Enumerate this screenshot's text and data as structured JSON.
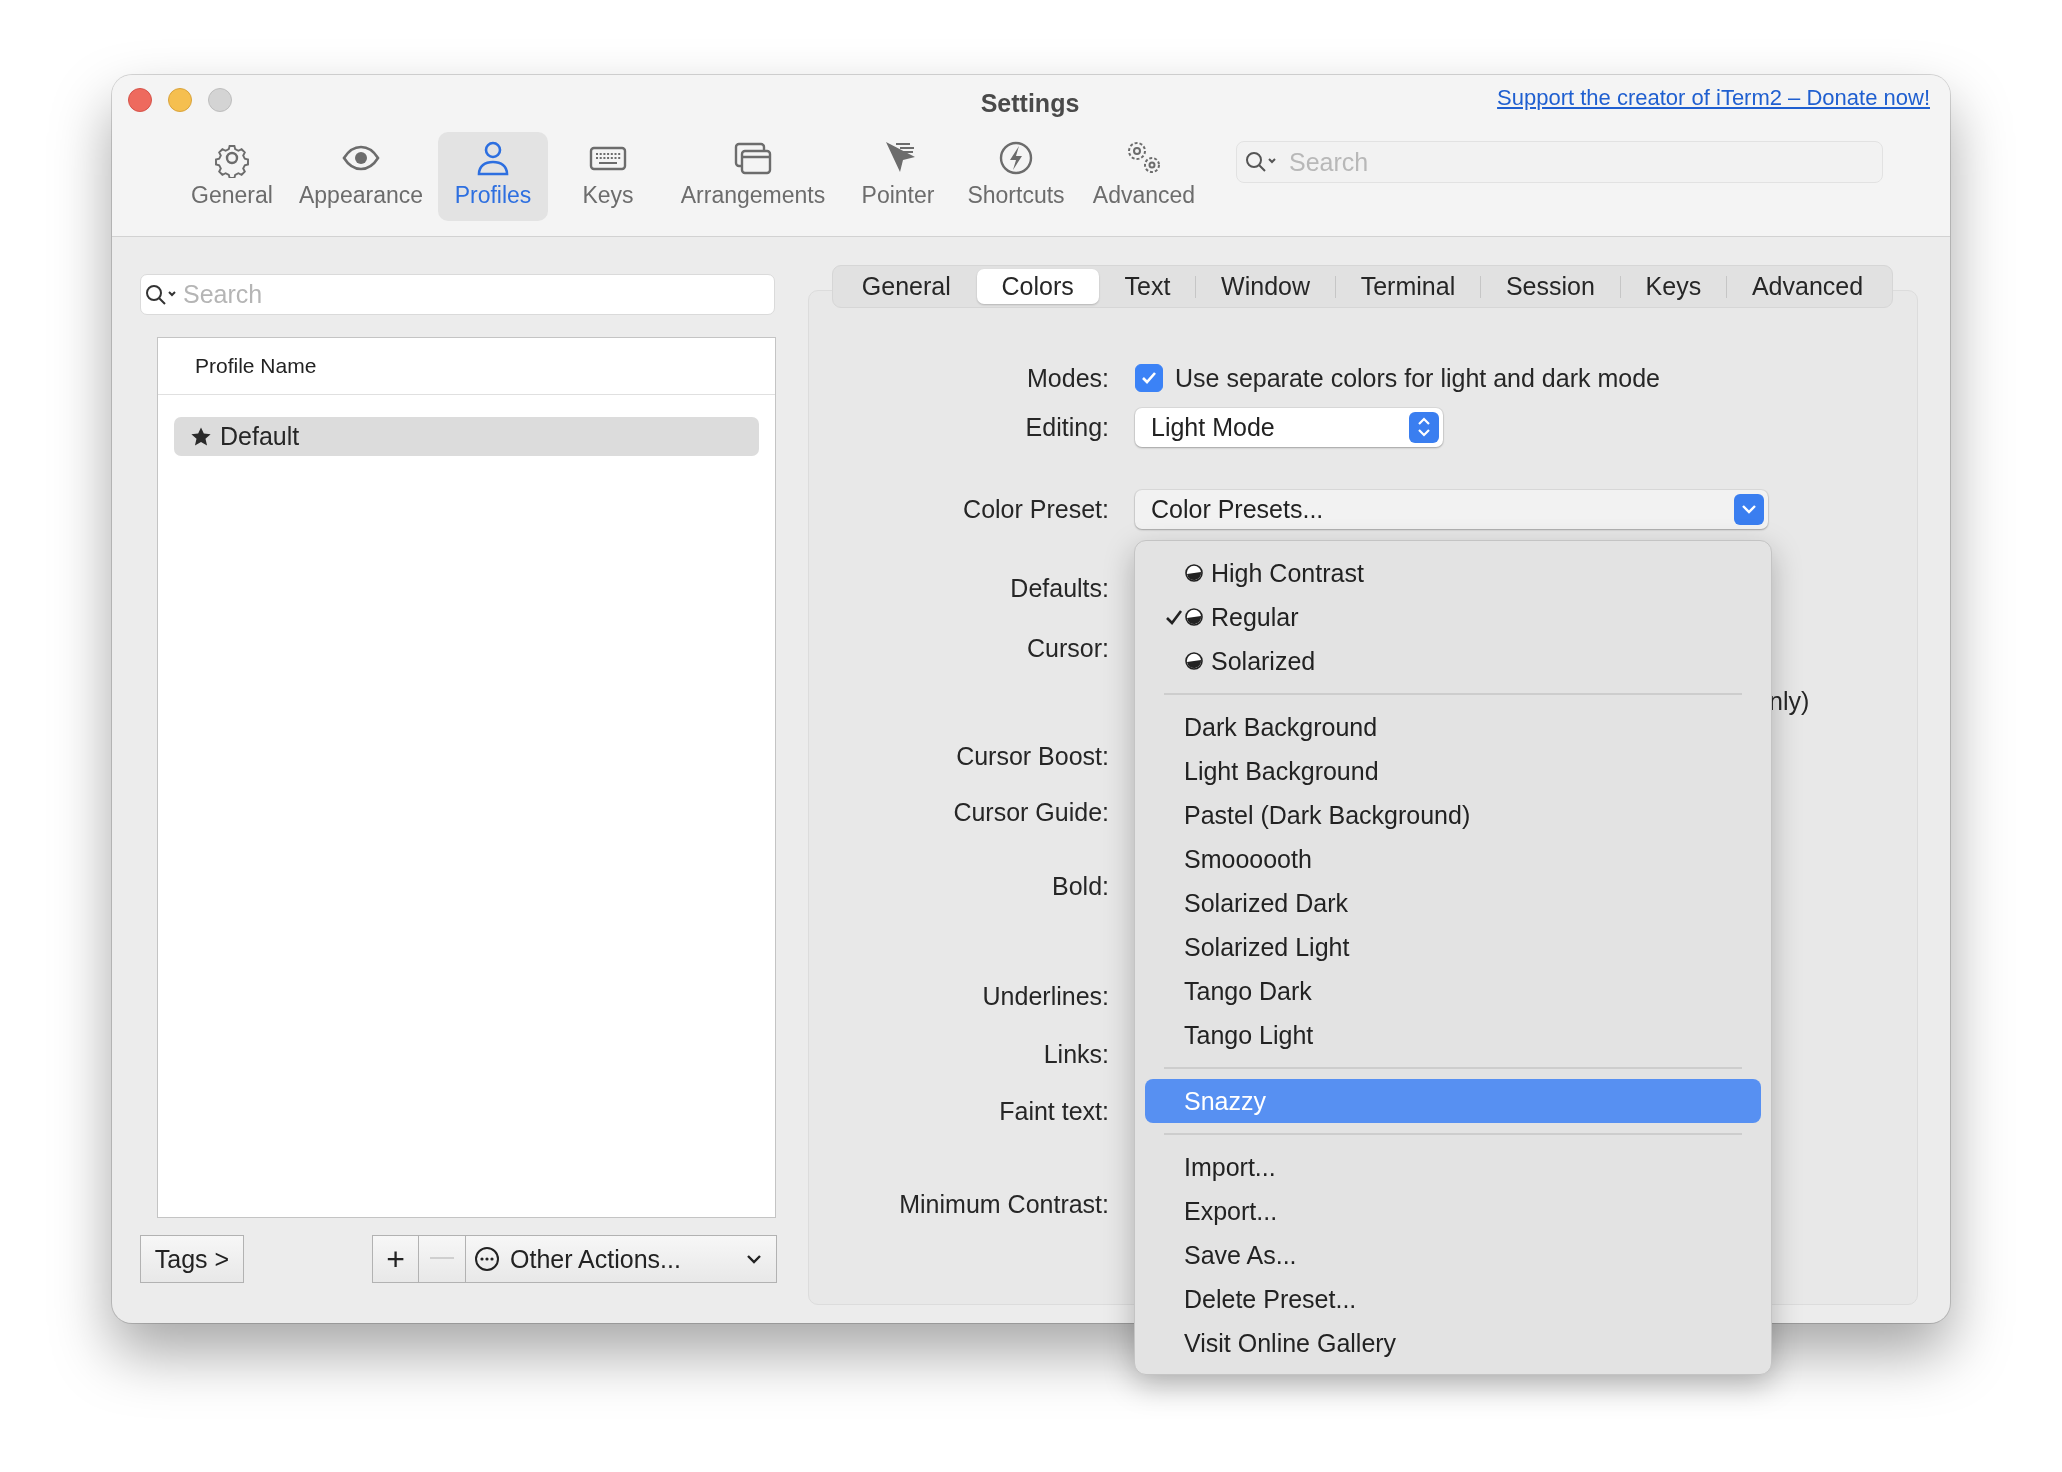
{
  "window": {
    "title": "Settings"
  },
  "donate_link": "Support the creator of iTerm2 – Donate now!",
  "toolbar": [
    {
      "label": "General",
      "selected": false
    },
    {
      "label": "Appearance",
      "selected": false
    },
    {
      "label": "Profiles",
      "selected": true
    },
    {
      "label": "Keys",
      "selected": false
    },
    {
      "label": "Arrangements",
      "selected": false
    },
    {
      "label": "Pointer",
      "selected": false
    },
    {
      "label": "Shortcuts",
      "selected": false
    },
    {
      "label": "Advanced",
      "selected": false
    }
  ],
  "toolbar_search": {
    "placeholder": "Search"
  },
  "profiles": {
    "search": {
      "placeholder": "Search"
    },
    "column": "Profile Name",
    "rows": [
      {
        "name": "Default",
        "selected": true,
        "is_default": true
      }
    ]
  },
  "bottom_bar": {
    "tags": "Tags >",
    "add": "+",
    "remove_disabled": true,
    "other_actions": "Other Actions..."
  },
  "profile_tabs": [
    {
      "label": "General",
      "selected": false
    },
    {
      "label": "Colors",
      "selected": true
    },
    {
      "label": "Text",
      "selected": false
    },
    {
      "label": "Window",
      "selected": false
    },
    {
      "label": "Terminal",
      "selected": false
    },
    {
      "label": "Session",
      "selected": false
    },
    {
      "label": "Keys",
      "selected": false
    },
    {
      "label": "Advanced",
      "selected": false
    }
  ],
  "form": [
    {
      "label": "Modes:",
      "kind": "checkbox",
      "text": "Use separate colors for light and dark mode",
      "checked": true
    },
    {
      "label": "Editing:",
      "kind": "popup",
      "value": "Light Mode"
    },
    {
      "label": "Color Preset:",
      "kind": "pulldown",
      "value": "Color Presets..."
    },
    {
      "label": "Defaults:",
      "kind": "label"
    },
    {
      "label": "Cursor:",
      "kind": "label"
    },
    {
      "label": "Cursor Boost:",
      "kind": "label"
    },
    {
      "label": "Cursor Guide:",
      "kind": "label"
    },
    {
      "label": "Bold:",
      "kind": "label"
    },
    {
      "label": "Underlines:",
      "kind": "label"
    },
    {
      "label": "Links:",
      "kind": "label"
    },
    {
      "label": "Faint text:",
      "kind": "label"
    },
    {
      "label": "Minimum Contrast:",
      "kind": "label"
    }
  ],
  "partial_text": "nly)",
  "menu": [
    {
      "kind": "item",
      "label": "High Contrast",
      "icon": true,
      "checked": false,
      "highlighted": false
    },
    {
      "kind": "item",
      "label": "Regular",
      "icon": true,
      "checked": true,
      "highlighted": false
    },
    {
      "kind": "item",
      "label": "Solarized",
      "icon": true,
      "checked": false,
      "highlighted": false
    },
    {
      "kind": "separator"
    },
    {
      "kind": "item",
      "label": "Dark Background",
      "icon": false,
      "checked": false,
      "highlighted": false
    },
    {
      "kind": "item",
      "label": "Light Background",
      "icon": false,
      "checked": false,
      "highlighted": false
    },
    {
      "kind": "item",
      "label": "Pastel (Dark Background)",
      "icon": false,
      "checked": false,
      "highlighted": false
    },
    {
      "kind": "item",
      "label": "Smoooooth",
      "icon": false,
      "checked": false,
      "highlighted": false
    },
    {
      "kind": "item",
      "label": "Solarized Dark",
      "icon": false,
      "checked": false,
      "highlighted": false
    },
    {
      "kind": "item",
      "label": "Solarized Light",
      "icon": false,
      "checked": false,
      "highlighted": false
    },
    {
      "kind": "item",
      "label": "Tango Dark",
      "icon": false,
      "checked": false,
      "highlighted": false
    },
    {
      "kind": "item",
      "label": "Tango Light",
      "icon": false,
      "checked": false,
      "highlighted": false
    },
    {
      "kind": "separator"
    },
    {
      "kind": "item",
      "label": "Snazzy",
      "icon": false,
      "checked": false,
      "highlighted": true
    },
    {
      "kind": "separator"
    },
    {
      "kind": "item",
      "label": "Import...",
      "icon": false,
      "checked": false,
      "highlighted": false
    },
    {
      "kind": "item",
      "label": "Export...",
      "icon": false,
      "checked": false,
      "highlighted": false
    },
    {
      "kind": "item",
      "label": "Save As...",
      "icon": false,
      "checked": false,
      "highlighted": false
    },
    {
      "kind": "item",
      "label": "Delete Preset...",
      "icon": false,
      "checked": false,
      "highlighted": false
    },
    {
      "kind": "item",
      "label": "Visit Online Gallery",
      "icon": false,
      "checked": false,
      "highlighted": false
    }
  ]
}
